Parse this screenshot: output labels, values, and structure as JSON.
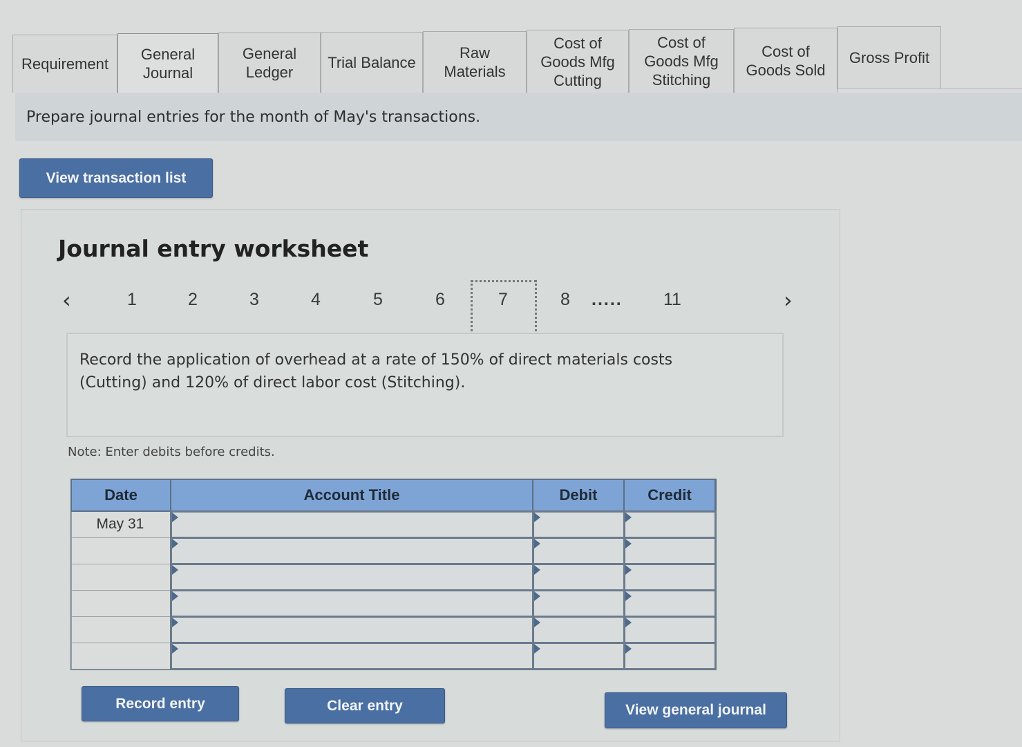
{
  "tabs": [
    {
      "label": "Requirement",
      "active": false
    },
    {
      "label": "General\nJournal",
      "active": true
    },
    {
      "label": "General\nLedger",
      "active": false
    },
    {
      "label": "Trial Balance",
      "active": false
    },
    {
      "label": "Raw\nMaterials",
      "active": false
    },
    {
      "label": "Cost of\nGoods Mfg\nCutting",
      "active": false
    },
    {
      "label": "Cost of\nGoods Mfg\nStitching",
      "active": false
    },
    {
      "label": "Cost of\nGoods Sold",
      "active": false
    },
    {
      "label": "Gross Profit",
      "active": false
    }
  ],
  "instruction": "Prepare journal entries for the month of May's transactions.",
  "view_transaction_list_label": "View transaction list",
  "worksheet": {
    "title": "Journal entry worksheet",
    "pager": {
      "prev_icon": "chevron-left-icon",
      "next_icon": "chevron-right-icon",
      "items": [
        "1",
        "2",
        "3",
        "4",
        "5",
        "6",
        "7",
        "8",
        ".....",
        "11"
      ],
      "current": "7"
    },
    "description": "Record the application of overhead at a rate of 150% of direct materials costs (Cutting) and 120% of direct labor cost (Stitching).",
    "note": "Note: Enter debits before credits.",
    "table": {
      "headers": {
        "date": "Date",
        "account": "Account Title",
        "debit": "Debit",
        "credit": "Credit"
      },
      "rows": [
        {
          "date": "May 31",
          "account": "",
          "debit": "",
          "credit": ""
        },
        {
          "date": "",
          "account": "",
          "debit": "",
          "credit": ""
        },
        {
          "date": "",
          "account": "",
          "debit": "",
          "credit": ""
        },
        {
          "date": "",
          "account": "",
          "debit": "",
          "credit": ""
        },
        {
          "date": "",
          "account": "",
          "debit": "",
          "credit": ""
        },
        {
          "date": "",
          "account": "",
          "debit": "",
          "credit": ""
        }
      ]
    },
    "buttons": {
      "record": "Record entry",
      "clear": "Clear entry",
      "view_journal": "View general journal"
    }
  },
  "colors": {
    "button_bg": "#4a6fa3",
    "table_header_bg": "#7ea4d6",
    "background": "#d9dcdb"
  }
}
